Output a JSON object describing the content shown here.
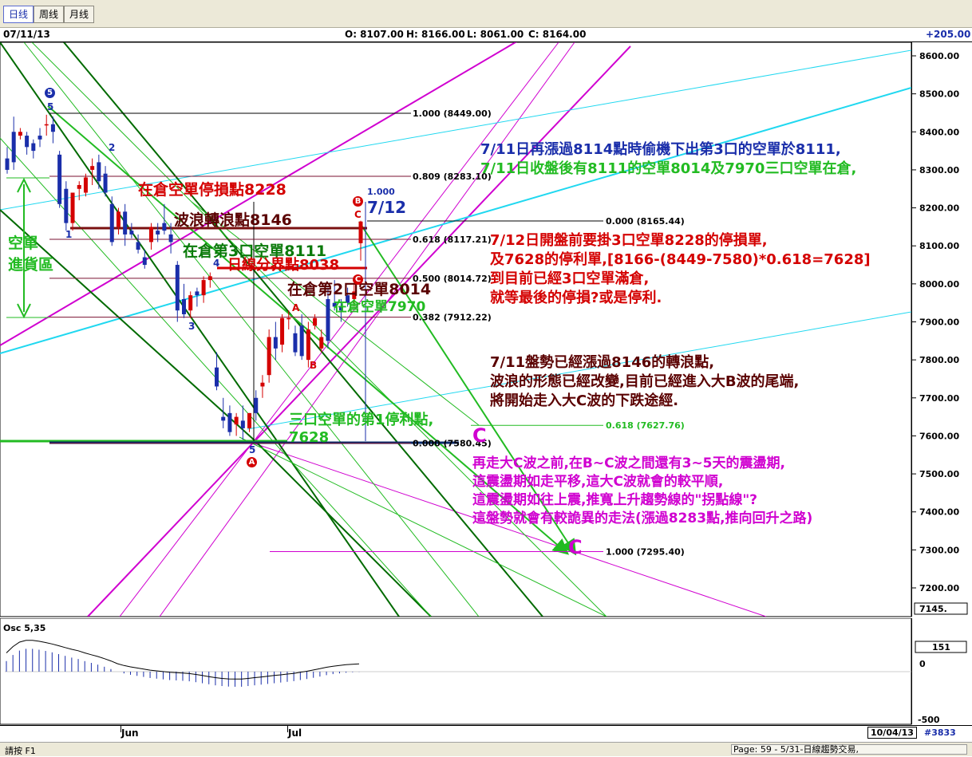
{
  "toolbar": {
    "tabs": [
      "日线",
      "周线",
      "月线"
    ],
    "active": 0
  },
  "info": {
    "date": "07/11/13",
    "open": "O: 8107.00",
    "high": "H: 8166.00",
    "low": "L: 8061.00",
    "close": "C: 8164.00",
    "change": "+205.00"
  },
  "chart_data": {
    "type": "candlestick",
    "ylim": [
      7145,
      8620
    ],
    "yticks": [
      "8600.00",
      "8500.00",
      "8400.00",
      "8300.00",
      "8200.00",
      "8100.00",
      "8000.00",
      "7900.00",
      "7800.00",
      "7700.00",
      "7600.00",
      "7500.00",
      "7400.00",
      "7300.00",
      "7200.00"
    ],
    "last_price": "7145.",
    "candles": [
      [
        8330,
        8360,
        8290,
        8300
      ],
      [
        8400,
        8440,
        8300,
        8320
      ],
      [
        8390,
        8410,
        8380,
        8400
      ],
      [
        8390,
        8400,
        8340,
        8360
      ],
      [
        8370,
        8380,
        8330,
        8350
      ],
      [
        8390,
        8410,
        8360,
        8380
      ],
      [
        8420,
        8445,
        8390,
        8420
      ],
      [
        8420,
        8440,
        8370,
        8400
      ],
      [
        8340,
        8350,
        8200,
        8210
      ],
      [
        8250,
        8270,
        8140,
        8160
      ],
      [
        8160,
        8240,
        8140,
        8240
      ],
      [
        8250,
        8270,
        8220,
        8260
      ],
      [
        8240,
        8290,
        8230,
        8280
      ],
      [
        8300,
        8330,
        8260,
        8310
      ],
      [
        8320,
        8340,
        8250,
        8270
      ],
      [
        8290,
        8310,
        8230,
        8240
      ],
      [
        8210,
        8230,
        8100,
        8110
      ],
      [
        8150,
        8200,
        8130,
        8190
      ],
      [
        8190,
        8210,
        8100,
        8130
      ],
      [
        8140,
        8160,
        8120,
        8130
      ],
      [
        8110,
        8130,
        8080,
        8090
      ],
      [
        8070,
        8090,
        8040,
        8050
      ],
      [
        8110,
        8160,
        8090,
        8150
      ],
      [
        8140,
        8160,
        8110,
        8130
      ],
      [
        8160,
        8210,
        8130,
        8140
      ],
      [
        8130,
        8160,
        8080,
        8110
      ],
      [
        8050,
        8060,
        7900,
        7930
      ],
      [
        7960,
        8000,
        7910,
        7920
      ],
      [
        7930,
        7980,
        7910,
        7970
      ],
      [
        7980,
        7990,
        7940,
        7970
      ],
      [
        7970,
        8020,
        7950,
        8010
      ],
      [
        8010,
        8030,
        7990,
        8020
      ],
      [
        7780,
        7820,
        7720,
        7730
      ],
      [
        7650,
        7700,
        7620,
        7640
      ],
      [
        7660,
        7680,
        7600,
        7610
      ],
      [
        7630,
        7660,
        7600,
        7650
      ],
      [
        7640,
        7680,
        7590,
        7620
      ],
      [
        7620,
        7660,
        7610,
        7660
      ],
      [
        7700,
        7720,
        7640,
        7660
      ],
      [
        7730,
        7760,
        7700,
        7740
      ],
      [
        7760,
        7880,
        7740,
        7860
      ],
      [
        7860,
        7900,
        7800,
        7830
      ],
      [
        7840,
        7920,
        7820,
        7910
      ],
      [
        7910,
        7930,
        7880,
        7910
      ],
      [
        7870,
        7890,
        7810,
        7820
      ],
      [
        7890,
        7920,
        7800,
        7810
      ],
      [
        7800,
        7900,
        7780,
        7880
      ],
      [
        7890,
        7920,
        7880,
        7910
      ],
      [
        7830,
        7880,
        7820,
        7860
      ],
      [
        7960,
        7990,
        7830,
        7850
      ],
      [
        7950,
        8010,
        7930,
        7940
      ],
      [
        7940,
        7960,
        7900,
        7930
      ],
      [
        7970,
        7990,
        7940,
        7950
      ],
      [
        7960,
        8000,
        7940,
        7980
      ],
      [
        8107,
        8166,
        8061,
        8164
      ]
    ],
    "fib_levels": [
      {
        "label": "1.000 (8449.00)",
        "value": 8449.0
      },
      {
        "label": "0.809 (8283.10)",
        "value": 8283.1
      },
      {
        "label": "0.618 (8117.21)",
        "value": 8117.21
      },
      {
        "label": "0.500 (8014.72)",
        "value": 8014.72
      },
      {
        "label": "0.382 (7912.22)",
        "value": 7912.22
      },
      {
        "label": "0.000 (7580.45)",
        "value": 7580.45
      }
    ],
    "fib2_levels": [
      {
        "label": "0.000 (8165.44)",
        "value": 8165.44
      },
      {
        "label": "0.618 (7627.76)",
        "value": 7627.76
      },
      {
        "label": "1.000 (7295.40)",
        "value": 7295.4
      },
      {
        "label": "1.000",
        "value": 8220
      }
    ],
    "x_labels": [
      "Jun",
      "Jul"
    ],
    "osc_label": "Osc 5,35",
    "osc_value": "151",
    "osc_ticks": [
      "0",
      "-500"
    ],
    "osc_values": [
      60,
      95,
      120,
      130,
      130,
      125,
      118,
      110,
      100,
      90,
      80,
      72,
      60,
      50,
      40,
      28,
      15,
      0,
      -10,
      -18,
      -24,
      -30,
      -36,
      -40,
      -44,
      -48,
      -50,
      -52,
      -55,
      -60,
      -66,
      -72,
      -78,
      -82,
      -85,
      -86,
      -86,
      -82,
      -78,
      -74,
      -70,
      -66,
      -62,
      -58,
      -54,
      -48,
      -42,
      -35,
      -28,
      -20,
      -14,
      -10,
      -6,
      -3,
      -1
    ]
  },
  "annotations": {
    "stop_loss": "在倉空單停損點8228",
    "wave_turn": "波浪轉浪點8146",
    "short3": "在倉第3口空單8111",
    "daily_boundary": "日線分界點8038",
    "short2": "在倉第2口空單8014",
    "short1": "在倉空單7970",
    "take_profit_1": "三口空單的第1停利點,",
    "take_profit_2": "7628",
    "entry_zone_1": "空單",
    "entry_zone_2": "進貨區",
    "date_712": "7/12",
    "blue_1": "7/11日再漲過8114點時偷機下出第3口的空單於8111,",
    "blue_2": "7/11日收盤後有8111的空單8014及7970三口空單在倉,",
    "red_1": "7/12日開盤前要掛3口空單8228的停損單,",
    "red_2": "及7628的停利單,[8166-(8449-7580)*0.618=7628]",
    "red_3": "到目前已經3口空單滿倉,",
    "red_4": "就等最後的停損?或是停利.",
    "dr_1": "7/11盤勢已經漲過8146的轉浪點,",
    "dr_2": "波浪的形態已經改變,目前已經進入大B波的尾端,",
    "dr_3": "將開始走入大C波的下跌途經.",
    "mg_1": "再走大C波之前,在B~C波之間還有3~5天的震盪期,",
    "mg_2": "這震盪期如走平移,這大C波就會的較平順,",
    "mg_3": "這震盪期如往上震,推寬上升趨勢線的\"拐點線\"?",
    "mg_4": "這盤勢就會有較詭異的走法(漲過8283點,推向回升之路)"
  },
  "wave_labels": {
    "w5": "5",
    "w5b": "5",
    "w1": "1",
    "w2": "2",
    "w3": "3",
    "w4": "4",
    "a_lower": "A",
    "b_lower": "B",
    "c_lower": "C",
    "a_circle": "A",
    "b_circle": "B",
    "c_circle": "C",
    "c_big": "C",
    "c_bottom": "C",
    "w5_low": "5"
  },
  "time_axis": {
    "end_date": "10/04/13",
    "bar_no": "#3833"
  },
  "status": {
    "left": "請按 F1",
    "right": "Page: 59 - 5/31-日線趨勢交易,"
  },
  "colors": {
    "up": "#d40000",
    "down": "#1a2eaa",
    "magenta": "#d000d0",
    "green": "#22bb22",
    "dark_green": "#006a00",
    "cyan": "#20d8f0"
  }
}
